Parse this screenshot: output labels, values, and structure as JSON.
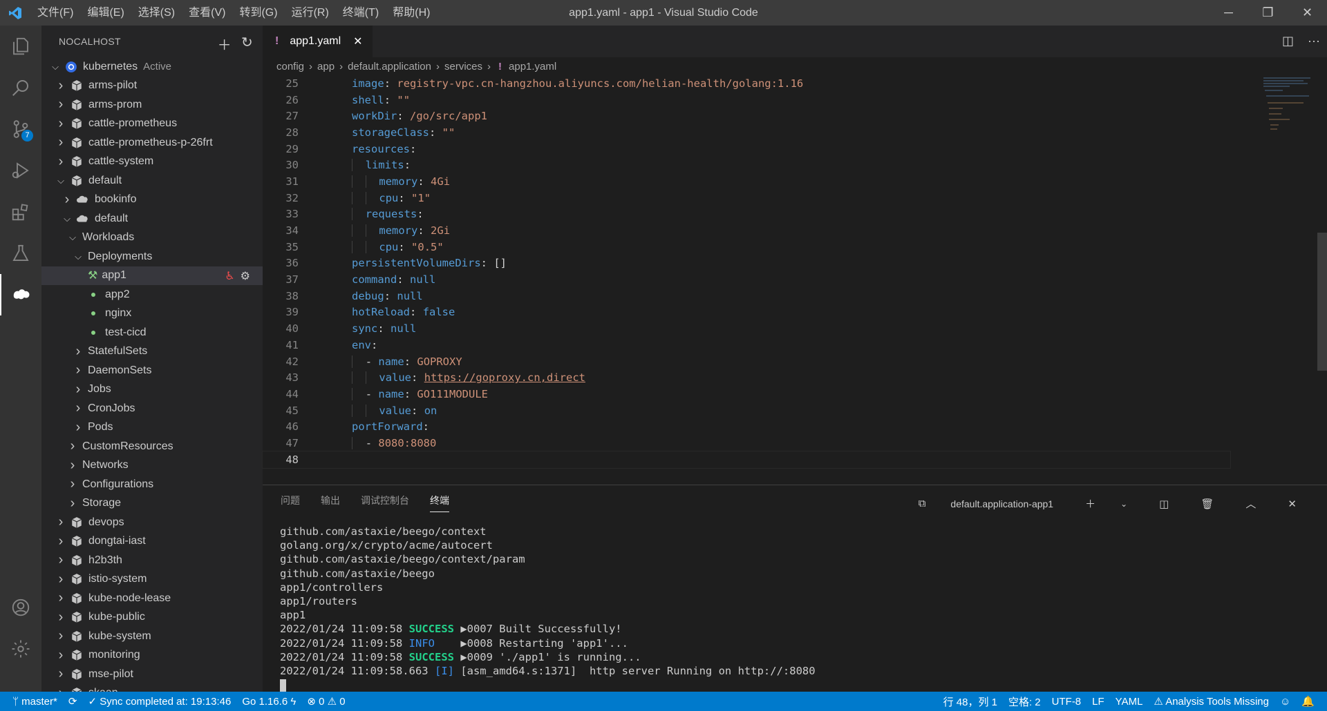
{
  "window": {
    "title": "app1.yaml - app1 - Visual Studio Code",
    "menu": [
      "文件(F)",
      "编辑(E)",
      "选择(S)",
      "查看(V)",
      "转到(G)",
      "运行(R)",
      "终端(T)",
      "帮助(H)"
    ]
  },
  "activity": {
    "scm_badge": "7"
  },
  "sidebar": {
    "title": "NOCALHOST",
    "cluster": {
      "name": "kubernetes",
      "status": "Active"
    },
    "namespaces_top": [
      "arms-pilot",
      "arms-prom",
      "cattle-prometheus",
      "cattle-prometheus-p-26frt",
      "cattle-system"
    ],
    "default_ns": "default",
    "apps": [
      "bookinfo",
      "default"
    ],
    "workloads": "Workloads",
    "deployments": "Deployments",
    "deployment_items": [
      "app1",
      "app2",
      "nginx",
      "test-cicd"
    ],
    "workload_types": [
      "StatefulSets",
      "DaemonSets",
      "Jobs",
      "CronJobs",
      "Pods"
    ],
    "groups": [
      "CustomResources",
      "Networks",
      "Configurations",
      "Storage"
    ],
    "namespaces_bottom": [
      "devops",
      "dongtai-iast",
      "h2b3th",
      "istio-system",
      "kube-node-lease",
      "kube-public",
      "kube-system",
      "monitoring",
      "mse-pilot",
      "skaan"
    ]
  },
  "editor": {
    "tab_label": "app1.yaml",
    "breadcrumb": [
      "config",
      "app",
      "default.application",
      "services",
      "app1.yaml"
    ],
    "current_line": "48"
  },
  "code_lines": [
    {
      "n": "25",
      "indent": 3,
      "key": "image",
      "val": "registry-vpc.cn-hangzhou.aliyuncs.com/helian-health/golang:1.16",
      "vt": "s"
    },
    {
      "n": "26",
      "indent": 3,
      "key": "shell",
      "val": "\"\"",
      "vt": "s"
    },
    {
      "n": "27",
      "indent": 3,
      "key": "workDir",
      "val": "/go/src/app1",
      "vt": "s"
    },
    {
      "n": "28",
      "indent": 3,
      "key": "storageClass",
      "val": "\"\"",
      "vt": "s"
    },
    {
      "n": "29",
      "indent": 3,
      "key": "resources",
      "val": "",
      "vt": "s"
    },
    {
      "n": "30",
      "indent": 4,
      "key": "limits",
      "val": "",
      "vt": "s"
    },
    {
      "n": "31",
      "indent": 5,
      "key": "memory",
      "val": "4Gi",
      "vt": "s"
    },
    {
      "n": "32",
      "indent": 5,
      "key": "cpu",
      "val": "\"1\"",
      "vt": "s"
    },
    {
      "n": "33",
      "indent": 4,
      "key": "requests",
      "val": "",
      "vt": "s"
    },
    {
      "n": "34",
      "indent": 5,
      "key": "memory",
      "val": "2Gi",
      "vt": "s"
    },
    {
      "n": "35",
      "indent": 5,
      "key": "cpu",
      "val": "\"0.5\"",
      "vt": "s"
    },
    {
      "n": "36",
      "indent": 3,
      "key": "persistentVolumeDirs",
      "val": "[]",
      "vt": "p"
    },
    {
      "n": "37",
      "indent": 3,
      "key": "command",
      "val": "null",
      "vt": "k"
    },
    {
      "n": "38",
      "indent": 3,
      "key": "debug",
      "val": "null",
      "vt": "k"
    },
    {
      "n": "39",
      "indent": 3,
      "key": "hotReload",
      "val": "false",
      "vt": "k"
    },
    {
      "n": "40",
      "indent": 3,
      "key": "sync",
      "val": "null",
      "vt": "k"
    },
    {
      "n": "41",
      "indent": 3,
      "key": "env",
      "val": "",
      "vt": "s"
    },
    {
      "n": "42",
      "indent": 4,
      "dash": true,
      "key": "name",
      "val": "GOPROXY",
      "vt": "s"
    },
    {
      "n": "43",
      "indent": 5,
      "key": "value",
      "val": "https://goproxy.cn,direct",
      "vt": "u"
    },
    {
      "n": "44",
      "indent": 4,
      "dash": true,
      "key": "name",
      "val": "GO111MODULE",
      "vt": "s"
    },
    {
      "n": "45",
      "indent": 5,
      "key": "value",
      "val": "on",
      "vt": "k"
    },
    {
      "n": "46",
      "indent": 3,
      "key": "portForward",
      "val": "",
      "vt": "s"
    },
    {
      "n": "47",
      "indent": 4,
      "dash": true,
      "key": "",
      "val": "8080:8080",
      "vt": "s"
    },
    {
      "n": "48",
      "indent": 0,
      "key": "",
      "val": "",
      "vt": "s"
    }
  ],
  "panel": {
    "tabs": [
      "问题",
      "输出",
      "调试控制台",
      "终端"
    ],
    "terminal_name": "default.application-app1"
  },
  "terminal": {
    "plain": [
      "github.com/astaxie/beego/context",
      "golang.org/x/crypto/acme/autocert",
      "github.com/astaxie/beego/context/param",
      "github.com/astaxie/beego",
      "app1/controllers",
      "app1/routers",
      "app1"
    ],
    "logs": [
      {
        "ts": "2022/01/24 11:09:58",
        "level": "SUCCESS",
        "cls": "succ",
        "msg": " ▶0007 Built Successfully!"
      },
      {
        "ts": "2022/01/24 11:09:58",
        "level": "INFO   ",
        "cls": "info",
        "msg": " ▶0008 Restarting 'app1'..."
      },
      {
        "ts": "2022/01/24 11:09:58",
        "level": "SUCCESS",
        "cls": "succ",
        "msg": " ▶0009 './app1' is running..."
      }
    ],
    "last_ts": "2022/01/24 11:09:58.663",
    "last_level": "[I]",
    "last_msg": " [asm_amd64.s:1371]  http server Running on http://:8080"
  },
  "status": {
    "branch": "master*",
    "sync": "Sync completed at: 19:13:46",
    "go": "Go 1.16.6",
    "errors": "0",
    "warnings": "0",
    "position": "行 48，列 1",
    "spaces": "空格: 2",
    "encoding": "UTF-8",
    "eol": "LF",
    "lang": "YAML",
    "analysis": "Analysis Tools Missing"
  }
}
